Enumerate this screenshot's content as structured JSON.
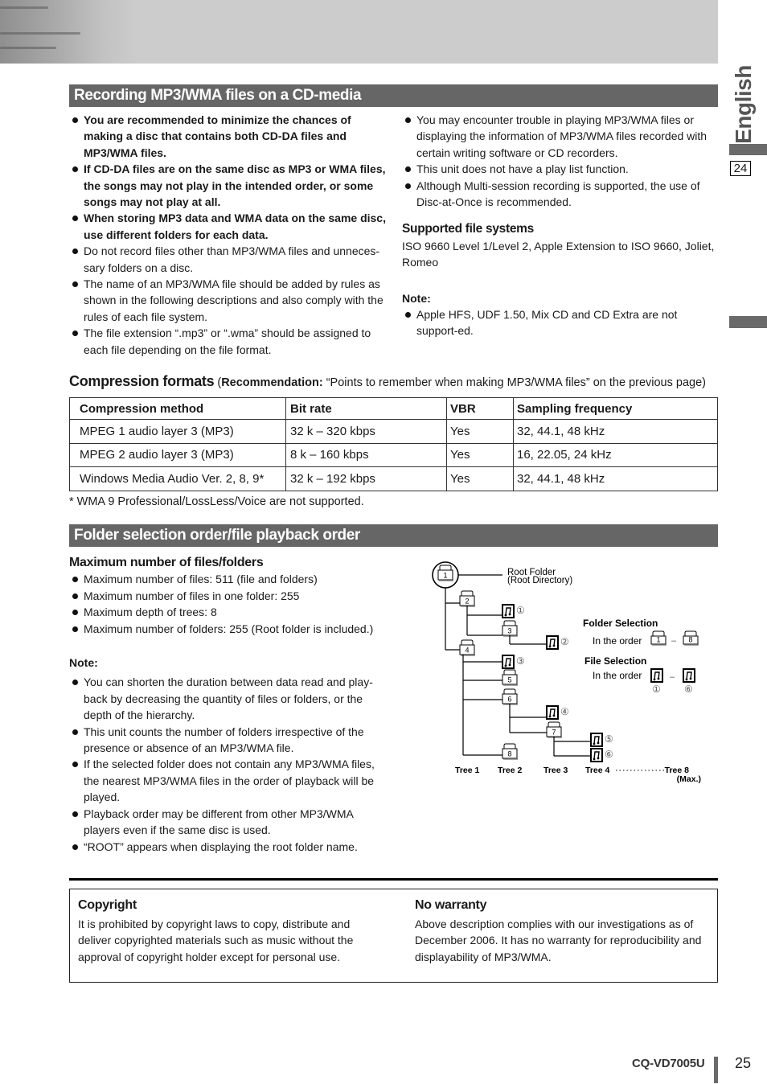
{
  "side": {
    "language": "English",
    "prev_page": "24"
  },
  "section1": {
    "title": "Recording MP3/WMA files on a CD-media",
    "left_bullets": [
      {
        "text": "You are recommended to minimize the chances of making a disc that contains both CD-DA files and MP3/WMA files.",
        "bold": true
      },
      {
        "text": "If CD-DA files are on the same disc as MP3 or WMA files, the songs may not play in the intended order, or some songs may not play at all.",
        "bold": true
      },
      {
        "text": "When storing MP3 data and WMA data on the same disc, use different folders for each data.",
        "bold": true
      },
      {
        "text": "Do not record files other than MP3/WMA files and unneces-sary folders on a disc.",
        "bold": false
      },
      {
        "text": "The name of an MP3/WMA file should be added by rules as shown in the following descriptions and also comply with the rules of each file system.",
        "bold": false
      },
      {
        "text": "The file extension “.mp3” or “.wma” should be assigned to each file depending on the file format.",
        "bold": false
      }
    ],
    "right_bullets": [
      "You may encounter trouble in playing MP3/WMA files or displaying the information of MP3/WMA files recorded with certain writing software or CD recorders.",
      "This unit does not have a play list function.",
      "Although Multi-session recording is supported, the use of Disc-at-Once is recommended."
    ],
    "supported_title": "Supported file systems",
    "supported_text": "ISO 9660 Level 1/Level 2, Apple Extension to ISO 9660, Joliet, Romeo",
    "note_label": "Note:",
    "note_bullets": [
      "Apple HFS, UDF 1.50, Mix CD and CD Extra are not support-ed."
    ]
  },
  "compression": {
    "title": "Compression formats",
    "open_paren": " (",
    "rec_label": "Recommendation:",
    "rec_text": " “Points to remember when making MP3/WMA files” on the previous page)",
    "headers": [
      "Compression method",
      "Bit rate",
      "VBR",
      "Sampling frequency"
    ],
    "rows": [
      [
        "MPEG 1 audio layer 3 (MP3)",
        "32 k – 320 kbps",
        "Yes",
        "32, 44.1, 48 kHz"
      ],
      [
        "MPEG 2 audio layer 3 (MP3)",
        "8 k – 160 kbps",
        "Yes",
        "16, 22.05, 24 kHz"
      ],
      [
        "Windows Media Audio Ver. 2, 8, 9*",
        "32 k – 192 kbps",
        "Yes",
        "32, 44.1, 48 kHz"
      ]
    ],
    "footnote": "* WMA 9 Professional/LossLess/Voice are not supported."
  },
  "section2": {
    "title": "Folder selection order/file playback order",
    "max_title": "Maximum number of files/folders",
    "max_bullets": [
      "Maximum number of files: 511 (file and folders)",
      "Maximum number of files in one folder: 255",
      "Maximum depth of trees: 8",
      "Maximum number of folders: 255 (Root folder is included.)"
    ],
    "note_label": "Note:",
    "note_bullets": [
      "You can shorten the duration between data read and play-back by decreasing the quantity of files or folders, or the depth of the hierarchy.",
      "This unit counts the number of folders irrespective of the presence or absence of an MP3/WMA file.",
      "If the selected folder does not contain any MP3/WMA files, the nearest MP3/WMA files in the order of playback will be played.",
      "Playback order may be different from other MP3/WMA players even if the same disc is used.",
      "“ROOT” appears when displaying the root folder name."
    ],
    "diagram": {
      "root_label_1": "Root Folder",
      "root_label_2": "(Root Directory)",
      "folders": [
        "1",
        "2",
        "3",
        "4",
        "5",
        "6",
        "7",
        "8"
      ],
      "files": [
        "①",
        "②",
        "③",
        "④",
        "⑤",
        "⑥"
      ],
      "folder_sel_title": "Folder Selection",
      "file_sel_title": "File Selection",
      "in_the_order": "In the order",
      "dash": "–",
      "folder_from": "1",
      "folder_to": "8",
      "file_from": "①",
      "file_to": "⑥",
      "trees": [
        "Tree 1",
        "Tree 2",
        "Tree 3",
        "Tree 4",
        "Tree 8"
      ],
      "max_label": "(Max.)"
    }
  },
  "footer_box": {
    "copyright_title": "Copyright",
    "copyright_text": "It is prohibited by copyright laws to copy, distribute and deliver copyrighted materials such as music without the approval of copyright holder except for personal use.",
    "warranty_title": "No warranty",
    "warranty_text": "Above description complies with our investigations as of December 2006. It has no warranty for reproducibility and displayability of MP3/WMA."
  },
  "footer": {
    "model": "CQ-VD7005U",
    "page": "25"
  }
}
